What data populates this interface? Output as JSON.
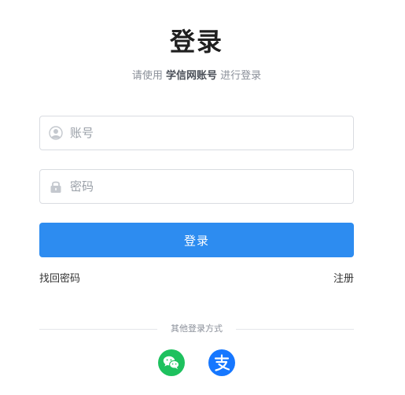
{
  "header": {
    "title": "登录",
    "subtitle_prefix": "请使用",
    "subtitle_highlight": "学信网账号",
    "subtitle_suffix": "进行登录"
  },
  "form": {
    "account_placeholder": "账号",
    "password_placeholder": "密码",
    "login_label": "登录",
    "forgot_label": "找回密码",
    "register_label": "注册"
  },
  "other_login": {
    "label": "其他登录方式",
    "methods": [
      {
        "icon": "wechat-icon",
        "color": "#1ec15e"
      },
      {
        "icon": "alipay-icon",
        "color": "#1677ff"
      }
    ]
  },
  "colors": {
    "primary": "#2d8cf0",
    "wechat": "#1ec15e",
    "alipay": "#1677ff"
  }
}
